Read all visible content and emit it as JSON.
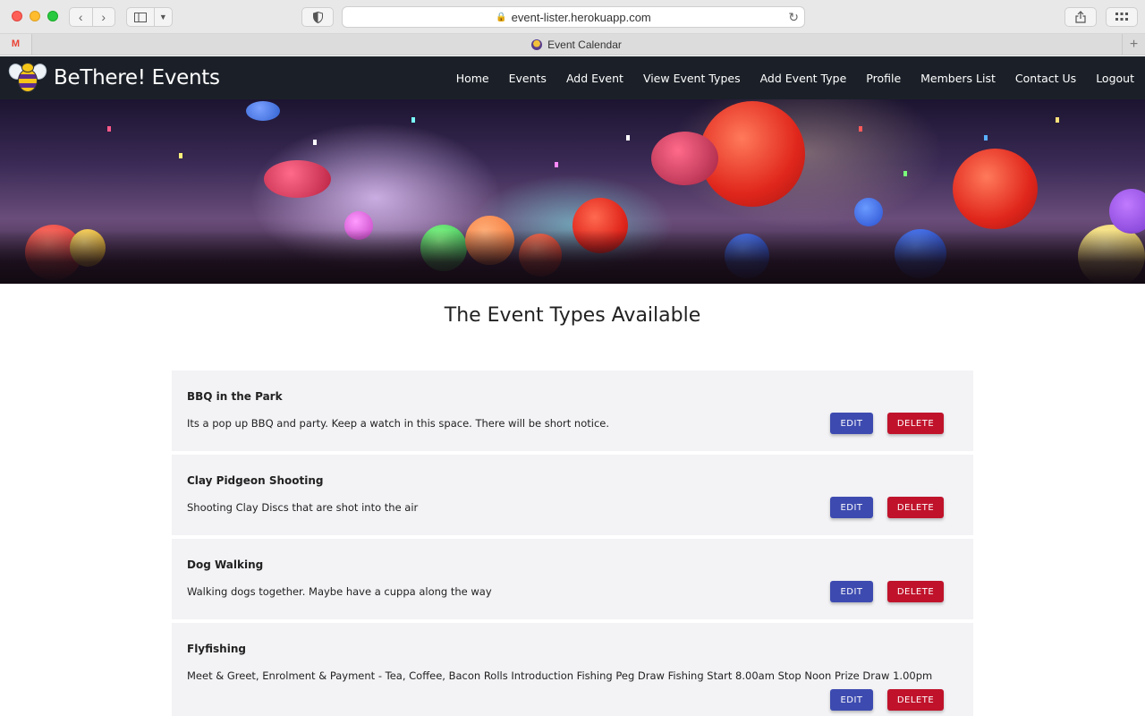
{
  "browser": {
    "url": "event-lister.herokuapp.com",
    "tab_title": "Event Calendar"
  },
  "site": {
    "brand": "BeThere! Events",
    "nav": [
      "Home",
      "Events",
      "Add Event",
      "View Event Types",
      "Add Event Type",
      "Profile",
      "Members List",
      "Contact Us",
      "Logout"
    ]
  },
  "main": {
    "title": "The Event Types Available",
    "edit_label": "EDIT",
    "delete_label": "DELETE",
    "event_types": [
      {
        "name": "BBQ in the Park",
        "description": "Its a pop up BBQ and party. Keep a watch in this space. There will be short notice."
      },
      {
        "name": "Clay Pidgeon Shooting",
        "description": "Shooting Clay Discs that are shot into the air"
      },
      {
        "name": "Dog Walking",
        "description": "Walking dogs together. Maybe have a cuppa along the way"
      },
      {
        "name": "Flyfishing",
        "description": "Meet & Greet, Enrolment & Payment - Tea, Coffee, Bacon Rolls Introduction Fishing Peg Draw Fishing Start 8.00am Stop Noon Prize Draw 1.00pm"
      }
    ]
  },
  "colors": {
    "navbar_bg": "#1b2028",
    "edit_button": "#3d4bb0",
    "delete_button": "#c0132b",
    "card_bg": "#f3f3f6"
  }
}
